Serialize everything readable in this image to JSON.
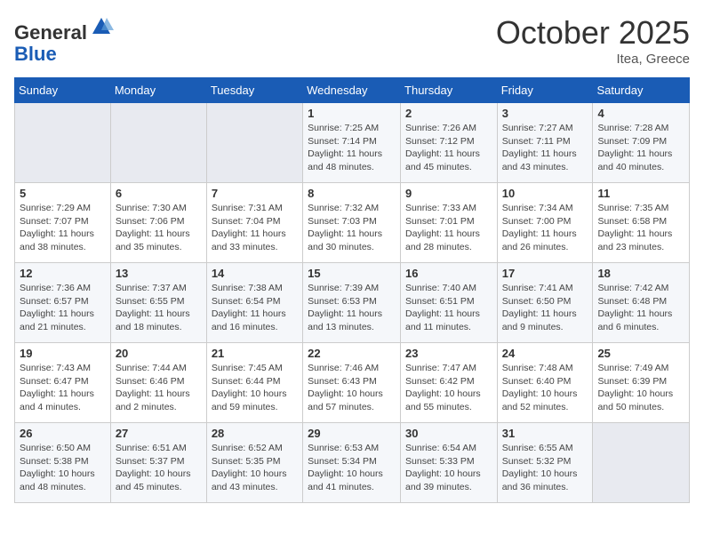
{
  "header": {
    "logo_line1": "General",
    "logo_line2": "Blue",
    "month": "October 2025",
    "location": "Itea, Greece"
  },
  "days_of_week": [
    "Sunday",
    "Monday",
    "Tuesday",
    "Wednesday",
    "Thursday",
    "Friday",
    "Saturday"
  ],
  "weeks": [
    [
      {
        "day": "",
        "sunrise": "",
        "sunset": "",
        "daylight": ""
      },
      {
        "day": "",
        "sunrise": "",
        "sunset": "",
        "daylight": ""
      },
      {
        "day": "",
        "sunrise": "",
        "sunset": "",
        "daylight": ""
      },
      {
        "day": "1",
        "sunrise": "Sunrise: 7:25 AM",
        "sunset": "Sunset: 7:14 PM",
        "daylight": "Daylight: 11 hours and 48 minutes."
      },
      {
        "day": "2",
        "sunrise": "Sunrise: 7:26 AM",
        "sunset": "Sunset: 7:12 PM",
        "daylight": "Daylight: 11 hours and 45 minutes."
      },
      {
        "day": "3",
        "sunrise": "Sunrise: 7:27 AM",
        "sunset": "Sunset: 7:11 PM",
        "daylight": "Daylight: 11 hours and 43 minutes."
      },
      {
        "day": "4",
        "sunrise": "Sunrise: 7:28 AM",
        "sunset": "Sunset: 7:09 PM",
        "daylight": "Daylight: 11 hours and 40 minutes."
      }
    ],
    [
      {
        "day": "5",
        "sunrise": "Sunrise: 7:29 AM",
        "sunset": "Sunset: 7:07 PM",
        "daylight": "Daylight: 11 hours and 38 minutes."
      },
      {
        "day": "6",
        "sunrise": "Sunrise: 7:30 AM",
        "sunset": "Sunset: 7:06 PM",
        "daylight": "Daylight: 11 hours and 35 minutes."
      },
      {
        "day": "7",
        "sunrise": "Sunrise: 7:31 AM",
        "sunset": "Sunset: 7:04 PM",
        "daylight": "Daylight: 11 hours and 33 minutes."
      },
      {
        "day": "8",
        "sunrise": "Sunrise: 7:32 AM",
        "sunset": "Sunset: 7:03 PM",
        "daylight": "Daylight: 11 hours and 30 minutes."
      },
      {
        "day": "9",
        "sunrise": "Sunrise: 7:33 AM",
        "sunset": "Sunset: 7:01 PM",
        "daylight": "Daylight: 11 hours and 28 minutes."
      },
      {
        "day": "10",
        "sunrise": "Sunrise: 7:34 AM",
        "sunset": "Sunset: 7:00 PM",
        "daylight": "Daylight: 11 hours and 26 minutes."
      },
      {
        "day": "11",
        "sunrise": "Sunrise: 7:35 AM",
        "sunset": "Sunset: 6:58 PM",
        "daylight": "Daylight: 11 hours and 23 minutes."
      }
    ],
    [
      {
        "day": "12",
        "sunrise": "Sunrise: 7:36 AM",
        "sunset": "Sunset: 6:57 PM",
        "daylight": "Daylight: 11 hours and 21 minutes."
      },
      {
        "day": "13",
        "sunrise": "Sunrise: 7:37 AM",
        "sunset": "Sunset: 6:55 PM",
        "daylight": "Daylight: 11 hours and 18 minutes."
      },
      {
        "day": "14",
        "sunrise": "Sunrise: 7:38 AM",
        "sunset": "Sunset: 6:54 PM",
        "daylight": "Daylight: 11 hours and 16 minutes."
      },
      {
        "day": "15",
        "sunrise": "Sunrise: 7:39 AM",
        "sunset": "Sunset: 6:53 PM",
        "daylight": "Daylight: 11 hours and 13 minutes."
      },
      {
        "day": "16",
        "sunrise": "Sunrise: 7:40 AM",
        "sunset": "Sunset: 6:51 PM",
        "daylight": "Daylight: 11 hours and 11 minutes."
      },
      {
        "day": "17",
        "sunrise": "Sunrise: 7:41 AM",
        "sunset": "Sunset: 6:50 PM",
        "daylight": "Daylight: 11 hours and 9 minutes."
      },
      {
        "day": "18",
        "sunrise": "Sunrise: 7:42 AM",
        "sunset": "Sunset: 6:48 PM",
        "daylight": "Daylight: 11 hours and 6 minutes."
      }
    ],
    [
      {
        "day": "19",
        "sunrise": "Sunrise: 7:43 AM",
        "sunset": "Sunset: 6:47 PM",
        "daylight": "Daylight: 11 hours and 4 minutes."
      },
      {
        "day": "20",
        "sunrise": "Sunrise: 7:44 AM",
        "sunset": "Sunset: 6:46 PM",
        "daylight": "Daylight: 11 hours and 2 minutes."
      },
      {
        "day": "21",
        "sunrise": "Sunrise: 7:45 AM",
        "sunset": "Sunset: 6:44 PM",
        "daylight": "Daylight: 10 hours and 59 minutes."
      },
      {
        "day": "22",
        "sunrise": "Sunrise: 7:46 AM",
        "sunset": "Sunset: 6:43 PM",
        "daylight": "Daylight: 10 hours and 57 minutes."
      },
      {
        "day": "23",
        "sunrise": "Sunrise: 7:47 AM",
        "sunset": "Sunset: 6:42 PM",
        "daylight": "Daylight: 10 hours and 55 minutes."
      },
      {
        "day": "24",
        "sunrise": "Sunrise: 7:48 AM",
        "sunset": "Sunset: 6:40 PM",
        "daylight": "Daylight: 10 hours and 52 minutes."
      },
      {
        "day": "25",
        "sunrise": "Sunrise: 7:49 AM",
        "sunset": "Sunset: 6:39 PM",
        "daylight": "Daylight: 10 hours and 50 minutes."
      }
    ],
    [
      {
        "day": "26",
        "sunrise": "Sunrise: 6:50 AM",
        "sunset": "Sunset: 5:38 PM",
        "daylight": "Daylight: 10 hours and 48 minutes."
      },
      {
        "day": "27",
        "sunrise": "Sunrise: 6:51 AM",
        "sunset": "Sunset: 5:37 PM",
        "daylight": "Daylight: 10 hours and 45 minutes."
      },
      {
        "day": "28",
        "sunrise": "Sunrise: 6:52 AM",
        "sunset": "Sunset: 5:35 PM",
        "daylight": "Daylight: 10 hours and 43 minutes."
      },
      {
        "day": "29",
        "sunrise": "Sunrise: 6:53 AM",
        "sunset": "Sunset: 5:34 PM",
        "daylight": "Daylight: 10 hours and 41 minutes."
      },
      {
        "day": "30",
        "sunrise": "Sunrise: 6:54 AM",
        "sunset": "Sunset: 5:33 PM",
        "daylight": "Daylight: 10 hours and 39 minutes."
      },
      {
        "day": "31",
        "sunrise": "Sunrise: 6:55 AM",
        "sunset": "Sunset: 5:32 PM",
        "daylight": "Daylight: 10 hours and 36 minutes."
      },
      {
        "day": "",
        "sunrise": "",
        "sunset": "",
        "daylight": ""
      }
    ]
  ]
}
